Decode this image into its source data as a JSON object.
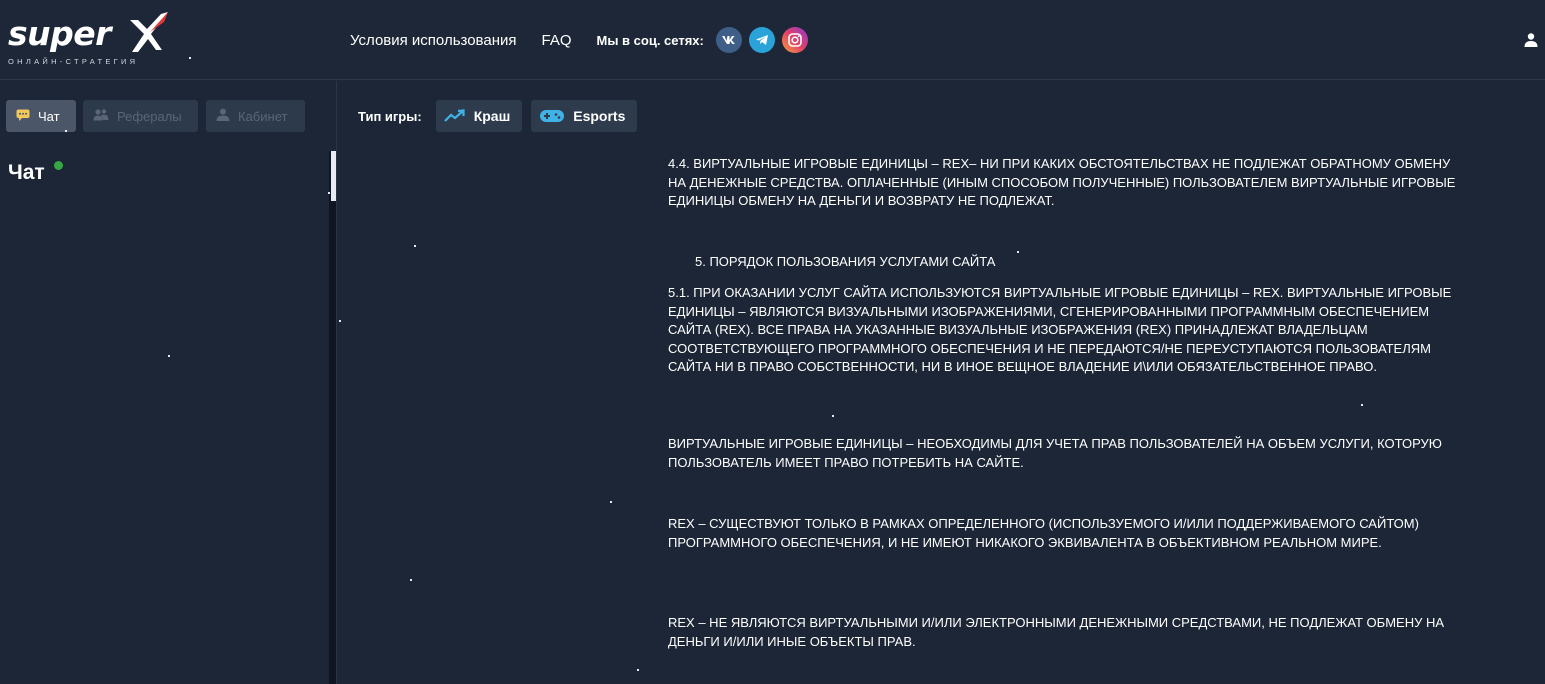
{
  "header": {
    "logo": {
      "word": "super",
      "tagline": "ОНЛАЙН-СТРАТЕГИЯ"
    },
    "nav": {
      "terms": "Условия использования",
      "faq": "FAQ",
      "social_label": "Мы в соц. сетях:"
    },
    "social": [
      {
        "name": "vk-icon",
        "color": "#3f5f88"
      },
      {
        "name": "telegram-icon",
        "color": "#2aa3d9"
      },
      {
        "name": "instagram-icon",
        "color": "#e05b3f"
      }
    ],
    "user_icon": "user-icon"
  },
  "sidebar": {
    "tabs": [
      {
        "label": "Чат",
        "icon": "chat-icon",
        "state": "active"
      },
      {
        "label": "Рефералы",
        "icon": "referrals-icon",
        "state": "disabled"
      },
      {
        "label": "Кабинет",
        "icon": "cabinet-icon",
        "state": "disabled"
      }
    ],
    "chat_title": "Чат",
    "online_color": "#36a745"
  },
  "game_type": {
    "label": "Тип игры:",
    "options": [
      {
        "label": "Краш",
        "icon": "crash-chart-icon"
      },
      {
        "label": "Esports",
        "icon": "gamepad-icon"
      }
    ]
  },
  "content": {
    "p_4_4": "4.4. Виртуальные игровые единицы – REX– ни при каких обстоятельствах не подлежат обратному обмену на денежные средства. Оплаченные (иным способом полученные) Пользователем виртуальные игровые единицы обмену на деньги и возврату не подлежат.",
    "h_5": "5. Порядок пользования услугами сайта",
    "p_5_1": "5.1. При оказании услуг сайта используются виртуальные игровые единицы – REX. Виртуальные игровые единицы – являются визуальными изображениями, сгенерированными программным обеспечением сайта (REX). Все права на указанные визуальные изображения (REX) принадлежат владельцам соответствующего программного обеспечения и не передаются/не переуступаются пользователям сайта ни в право собственности, ни в иное вещное владение и\\или обязательственное право.",
    "p_vig": "Виртуальные игровые единицы – необходимы для учета прав пользователей на объем услуги, которую пользователь имеет право потребить на сайте.",
    "p_rex1": "REX – существуют только в рамках определенного (используемого и/или поддерживаемого сайтом) программного обеспечения, и не имеют никакого эквивалента в объективном реальном мире.",
    "p_rex2": "REX – не являются виртуальными и/или электронными денежными средствами, не подлежат обмену на деньги и/или иные объекты прав."
  },
  "colors": {
    "background": "#1c2636",
    "button": "#2e3b4d",
    "accent_red": "#e03a3a"
  }
}
